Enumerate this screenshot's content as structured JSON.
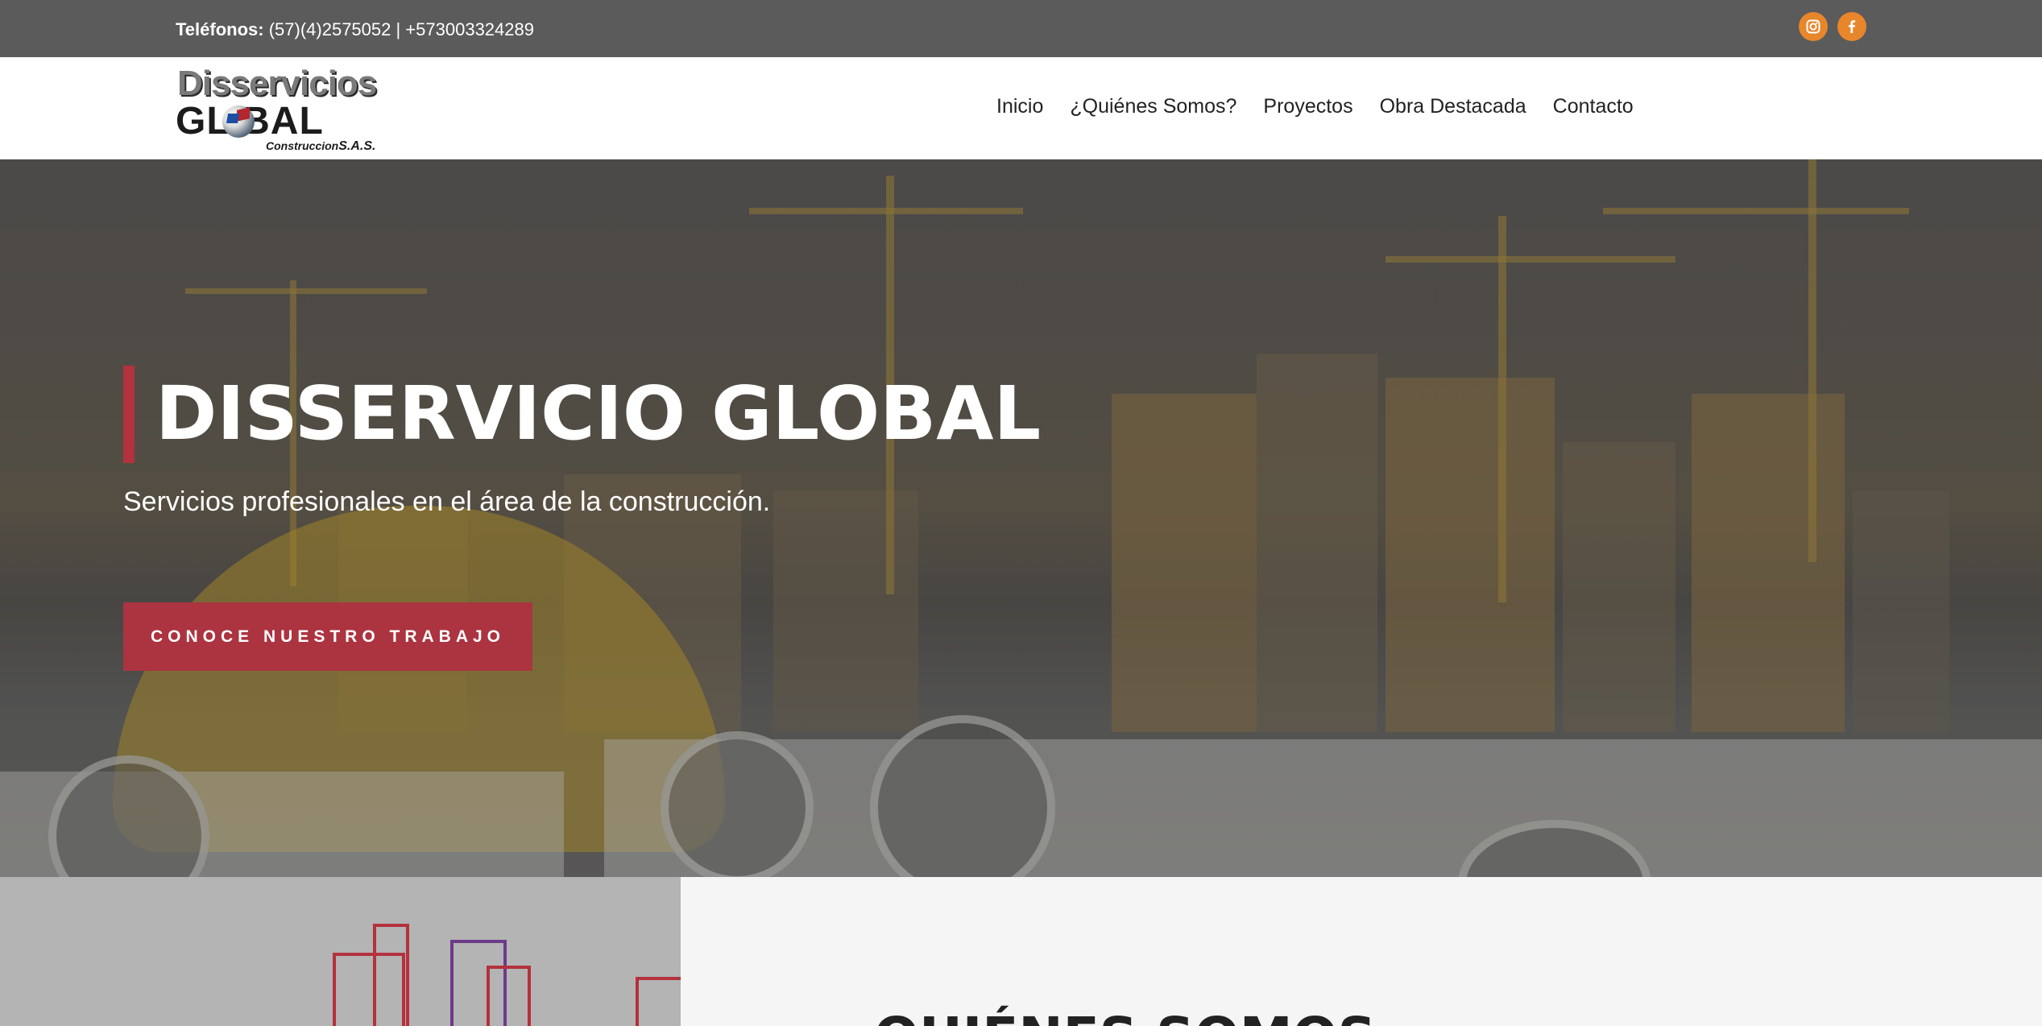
{
  "topbar": {
    "phones_label": "Teléfonos:",
    "phones_value": " (57)(4)2575052 | +573003324289",
    "social": [
      {
        "icon": "instagram-icon"
      },
      {
        "icon": "facebook-icon"
      }
    ],
    "social_color": "#e8862b",
    "background": "#5b5b5b"
  },
  "logo": {
    "line1": "Disservicios",
    "line2": "GL BAL",
    "line3": "Construccion",
    "line3_suffix": "S.A.S."
  },
  "nav": {
    "items": [
      "Inicio",
      "¿Quiénes Somos?",
      "Proyectos",
      "Obra Destacada",
      "Contacto"
    ]
  },
  "hero": {
    "title": "DISSERVICIO GLOBAL",
    "subtitle": "Servicios profesionales en el área de la construcción.",
    "cta_label": "CONOCE NUESTRO TRABAJO",
    "accent_color": "#b3323d",
    "cta_color": "#ab3440"
  },
  "about": {
    "heading": "QUIÉNES SOMOS"
  }
}
